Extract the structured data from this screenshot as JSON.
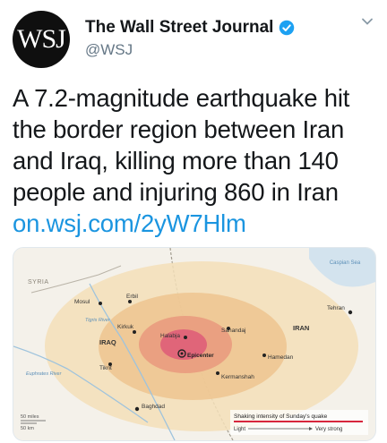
{
  "account": {
    "avatar_text": "WSJ",
    "display_name": "The Wall Street Journal",
    "handle": "@WSJ"
  },
  "tweet": {
    "text": "A 7.2-magnitude earthquake hit the border region between Iran and Iraq, killing more than 140 people and injuring 860 in Iran",
    "link": "on.wsj.com/2yW7Hlm"
  },
  "map": {
    "labels": {
      "syria": "SYRIA",
      "iraq": "IRAQ",
      "iran": "IRAN",
      "caspian": "Caspian Sea",
      "tigris": "Tigris River",
      "euphrates": "Euphrates River",
      "mosul": "Mosul",
      "erbil": "Erbil",
      "kirkuk": "Kirkuk",
      "halabja": "Halabja",
      "epicenter": "Epicenter",
      "sanandaj": "Sanandaj",
      "tehran": "Tehran",
      "hamedan": "Hamedan",
      "kermanshah": "Kermanshah",
      "tikrit": "Tikrit",
      "baghdad": "Baghdad"
    },
    "scale": {
      "miles": "50 miles",
      "km": "50 km"
    },
    "legend": {
      "title": "Shaking intensity of Sunday's quake",
      "light": "Light",
      "very_strong": "Very strong"
    },
    "colors": {
      "light": "#f3dfb8",
      "moderate": "#edc48f",
      "strong": "#e99b7e",
      "very_strong": "#de5a78",
      "legend_bar": "#d7263d"
    }
  },
  "icons": {
    "verified": "verified-badge-icon",
    "caret": "chevron-down-icon"
  }
}
